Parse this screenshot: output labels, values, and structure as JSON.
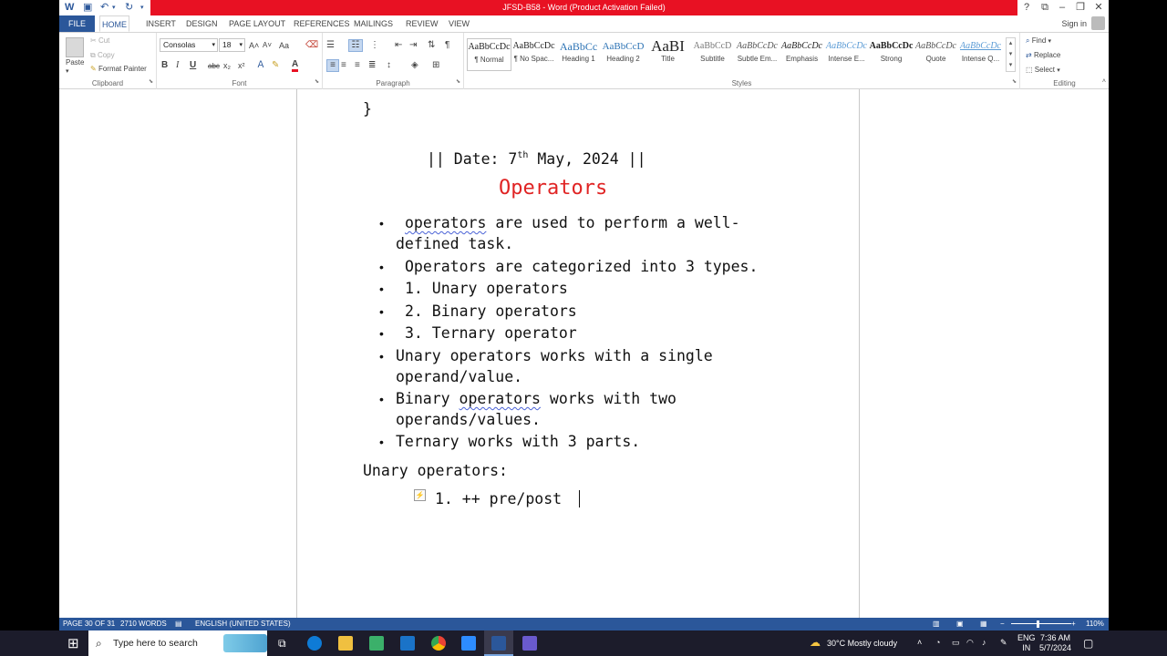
{
  "titlebar": {
    "title": "JFSD-B58 - Word (Product Activation Failed)",
    "help": "?"
  },
  "tabs": {
    "file": "FILE",
    "items": [
      "HOME",
      "INSERT",
      "DESIGN",
      "PAGE LAYOUT",
      "REFERENCES",
      "MAILINGS",
      "REVIEW",
      "VIEW"
    ],
    "active": "HOME",
    "sign_in": "Sign in"
  },
  "clipboard": {
    "paste": "Paste",
    "cut": "Cut",
    "copy": "Copy",
    "format_painter": "Format Painter",
    "label": "Clipboard"
  },
  "font": {
    "name": "Consolas",
    "size": "18",
    "label": "Font",
    "bold": "B",
    "italic": "I",
    "underline": "U",
    "strike": "abc",
    "sub": "x₂",
    "sup": "x²",
    "grow": "A˄",
    "shrink": "A˅",
    "case": "Aa",
    "color_a": "A"
  },
  "paragraph": {
    "label": "Paragraph",
    "pilcrow": "¶"
  },
  "styles": {
    "label": "Styles",
    "items": [
      {
        "preview": "AaBbCcDc",
        "name": "¶ Normal"
      },
      {
        "preview": "AaBbCcDc",
        "name": "¶ No Spac..."
      },
      {
        "preview": "AaBbCc",
        "name": "Heading 1"
      },
      {
        "preview": "AaBbCcD",
        "name": "Heading 2"
      },
      {
        "preview": "AaBI",
        "name": "Title"
      },
      {
        "preview": "AaBbCcD",
        "name": "Subtitle"
      },
      {
        "preview": "AaBbCcDc",
        "name": "Subtle Em..."
      },
      {
        "preview": "AaBbCcDc",
        "name": "Emphasis"
      },
      {
        "preview": "AaBbCcDc",
        "name": "Intense E..."
      },
      {
        "preview": "AaBbCcDc",
        "name": "Strong"
      },
      {
        "preview": "AaBbCcDc",
        "name": "Quote"
      },
      {
        "preview": "AaBbCcDc",
        "name": "Intense Q..."
      }
    ]
  },
  "editing": {
    "label": "Editing",
    "find": "Find",
    "replace": "Replace",
    "select": "Select"
  },
  "document": {
    "brace": "}",
    "date_prefix": "|| Date: 7",
    "date_sup": "th",
    "date_suffix": " May, 2024 ||",
    "heading": "Operators",
    "b1_word": "operators",
    "b1_rest": " are used to perform a well-",
    "b1_line2": "defined task.",
    "b2": "Operators are categorized into 3 types.",
    "b3": "1. Unary operators",
    "b4": "2. Binary operators",
    "b5": "3. Ternary operator",
    "b6_line1": "Unary operators works with a single",
    "b6_line2": "operand/value.",
    "b7_pre": "Binary ",
    "b7_word": "operators",
    "b7_rest": " works with two",
    "b7_line2": "operands/values.",
    "b8": "Ternary works with 3 parts.",
    "unary_heading": "Unary operators:",
    "list_item": "1.  ++  pre/post",
    "bullet": "•"
  },
  "status": {
    "page": "PAGE 30 OF 31",
    "words": "2710 WORDS",
    "language": "ENGLISH (UNITED STATES)",
    "zoom": "110%",
    "zoom_minus": "−",
    "zoom_plus": "+"
  },
  "taskbar": {
    "search_placeholder": "Type here to search",
    "weather": "30°C  Mostly cloudy",
    "lang1": "ENG",
    "lang2": "IN",
    "time": "7:36 AM",
    "date": "5/7/2024"
  }
}
